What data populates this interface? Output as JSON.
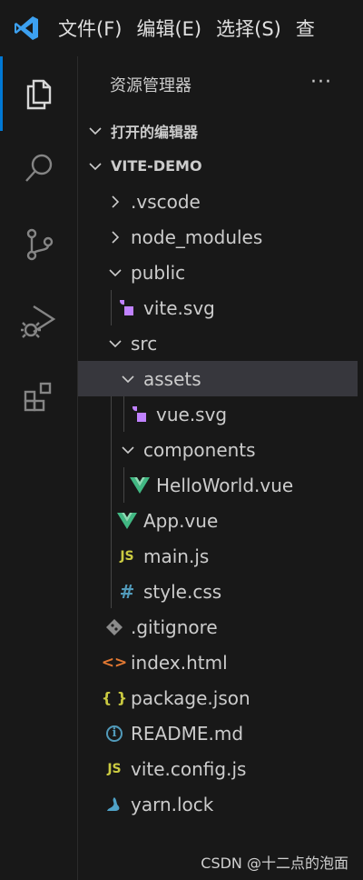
{
  "menu": [
    "文件(F)",
    "编辑(E)",
    "选择(S)",
    "查"
  ],
  "activity": {
    "items": [
      {
        "name": "explorer-icon"
      },
      {
        "name": "search-icon"
      },
      {
        "name": "source-control-icon"
      },
      {
        "name": "run-debug-icon"
      },
      {
        "name": "extensions-icon"
      }
    ]
  },
  "sidebar": {
    "title": "资源管理器",
    "more": "···",
    "open_editors": "打开的编辑器",
    "project": "VITE-DEMO",
    "tree": [
      {
        "label": ".vscode",
        "icon": "chevron-right"
      },
      {
        "label": "node_modules",
        "icon": "chevron-right"
      },
      {
        "label": "public",
        "icon": "chevron-down"
      },
      {
        "label": "vite.svg",
        "icon": "svg"
      },
      {
        "label": "src",
        "icon": "chevron-down"
      },
      {
        "label": "assets",
        "icon": "chevron-down",
        "selected": true
      },
      {
        "label": "vue.svg",
        "icon": "svg"
      },
      {
        "label": "components",
        "icon": "chevron-down"
      },
      {
        "label": "HelloWorld.vue",
        "icon": "vue"
      },
      {
        "label": "App.vue",
        "icon": "vue"
      },
      {
        "label": "main.js",
        "icon": "js"
      },
      {
        "label": "style.css",
        "icon": "css"
      },
      {
        "label": ".gitignore",
        "icon": "git"
      },
      {
        "label": "index.html",
        "icon": "html"
      },
      {
        "label": "package.json",
        "icon": "json"
      },
      {
        "label": "README.md",
        "icon": "info"
      },
      {
        "label": "vite.config.js",
        "icon": "js"
      },
      {
        "label": "yarn.lock",
        "icon": "yarn"
      }
    ]
  },
  "icons": {
    "js_glyph": "JS",
    "css_glyph": "#",
    "html_glyph": "<>",
    "json_glyph": "{ }",
    "info_glyph": "i"
  },
  "colors": {
    "accent": "#0078d4",
    "vscode_blue": "#3ca0f0",
    "vue_green": "#41b883",
    "svg_purple": "#c082ff",
    "js_yellow": "#cbcb41",
    "css_blue": "#519aba",
    "html_orange": "#e37933",
    "git_gray": "#8b8b8b",
    "json_yellow": "#cbcb41",
    "info_blue": "#519aba",
    "yarn_blue": "#4fa2c7"
  },
  "watermark": "CSDN @十二点的泡面"
}
